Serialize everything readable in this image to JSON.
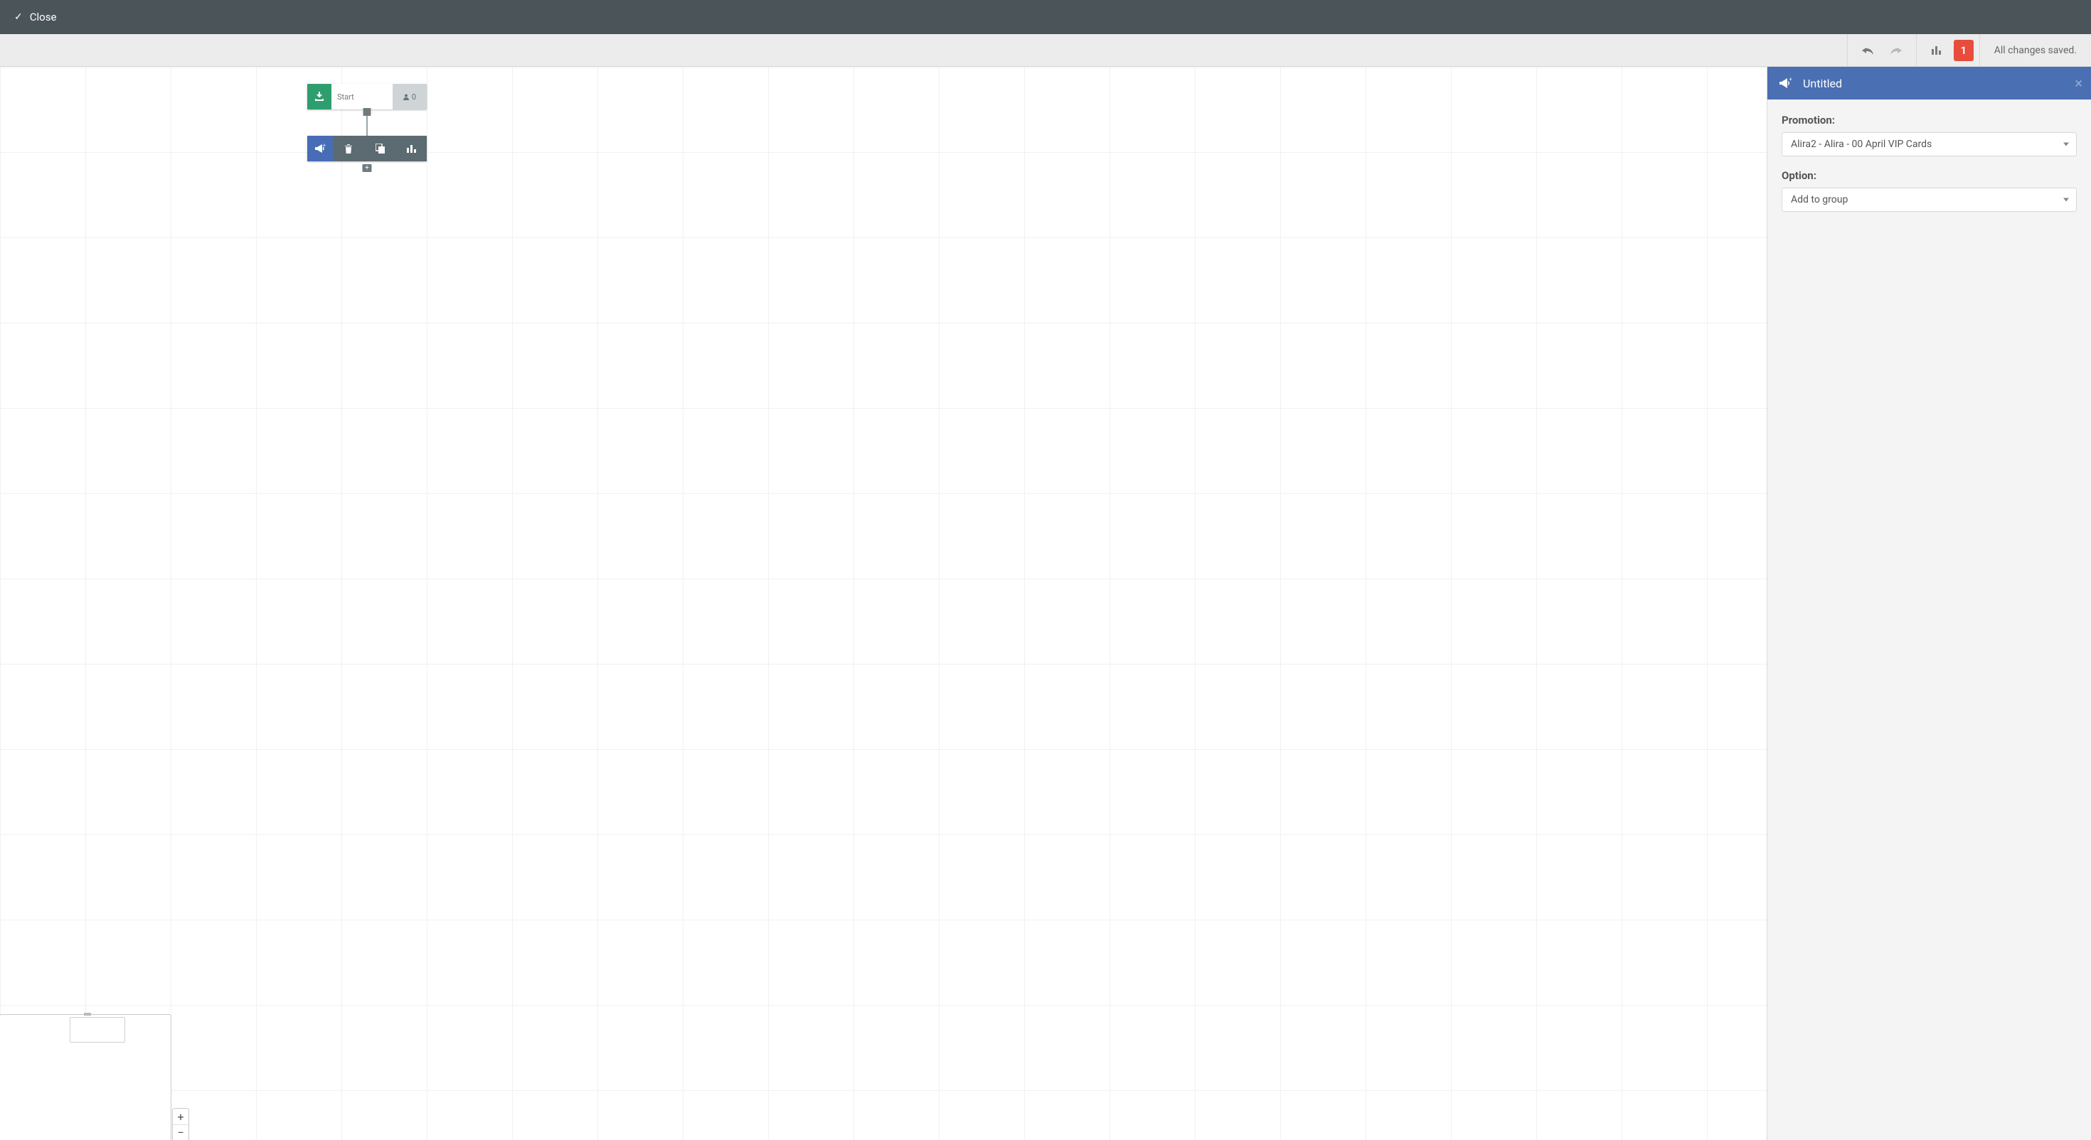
{
  "topbar": {
    "close_label": "Close"
  },
  "toolbar": {
    "error_count": "1",
    "status_text": "All changes saved."
  },
  "canvas": {
    "start_node": {
      "label": "Start",
      "count": "0"
    }
  },
  "zoom": {
    "in": "+",
    "out": "−"
  },
  "panel": {
    "title": "Untitled",
    "fields": {
      "promotion": {
        "label": "Promotion:",
        "value": "Alira2 - Alira - 00 April VIP Cards"
      },
      "option": {
        "label": "Option:",
        "value": "Add to group"
      }
    }
  }
}
